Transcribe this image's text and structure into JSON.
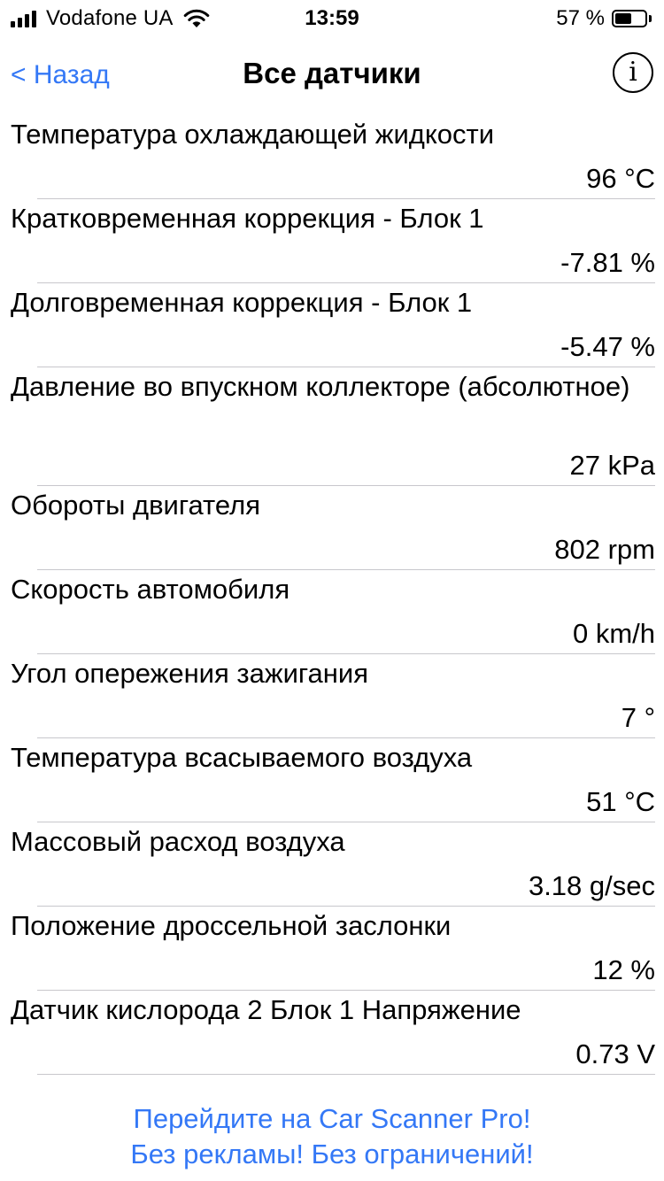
{
  "status_bar": {
    "carrier": "Vodafone UA",
    "time": "13:59",
    "battery_percent": "57 %",
    "battery_level": 0.57,
    "signal_icon": "signal-bars-icon",
    "wifi_icon": "wifi-icon",
    "battery_icon": "battery-icon"
  },
  "nav": {
    "back_label": "< Назад",
    "title": "Все датчики",
    "info_label": "i"
  },
  "sensors": [
    {
      "name": "Температура охлаждающей жидкости",
      "value": "96 °C"
    },
    {
      "name": "Кратковременная коррекция - Блок 1",
      "value": "-7.81 %"
    },
    {
      "name": "Долговременная коррекция - Блок 1",
      "value": "-5.47 %"
    },
    {
      "name": "Давление во впускном коллекторе (абсолютное)",
      "value": "27 kPa"
    },
    {
      "name": "Обороты двигателя",
      "value": "802 rpm"
    },
    {
      "name": "Скорость автомобиля",
      "value": "0 km/h"
    },
    {
      "name": "Угол опережения зажигания",
      "value": "7 °"
    },
    {
      "name": "Температура всасываемого воздуха",
      "value": "51 °C"
    },
    {
      "name": "Массовый расход воздуха",
      "value": "3.18 g/sec"
    },
    {
      "name": "Положение дроссельной заслонки",
      "value": "12 %"
    },
    {
      "name": "Датчик кислорода 2 Блок 1 Напряжение",
      "value": "0.73 V"
    }
  ],
  "promo": {
    "line1": "Перейдите на Car Scanner Pro!",
    "line2": "Без рекламы! Без ограничений!"
  },
  "colors": {
    "accent": "#3478f6",
    "separator": "#c8c7cc",
    "text": "#000000",
    "background": "#ffffff"
  }
}
